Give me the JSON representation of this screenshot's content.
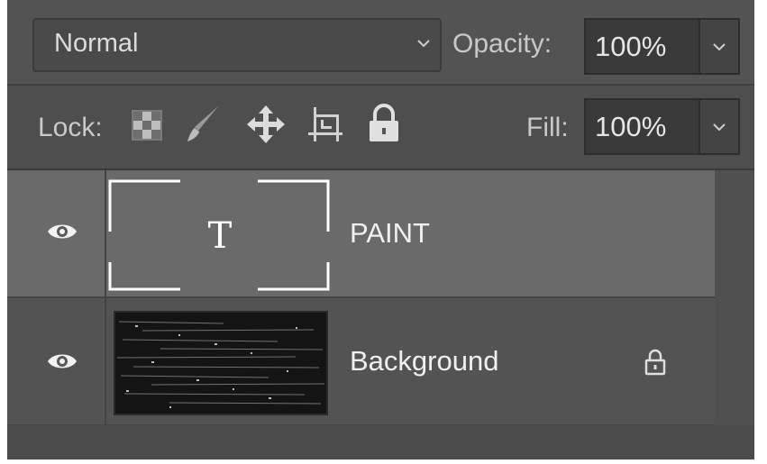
{
  "blend": {
    "mode": "Normal",
    "opacity_label": "Opacity:",
    "opacity_value": "100%"
  },
  "lock": {
    "label": "Lock:",
    "fill_label": "Fill:",
    "fill_value": "100%"
  },
  "layers": [
    {
      "name": "PAINT",
      "kind": "text",
      "thumb_glyph": "T",
      "selected": true,
      "visible": true
    },
    {
      "name": "Background",
      "kind": "image",
      "selected": false,
      "visible": true,
      "locked": true
    }
  ]
}
